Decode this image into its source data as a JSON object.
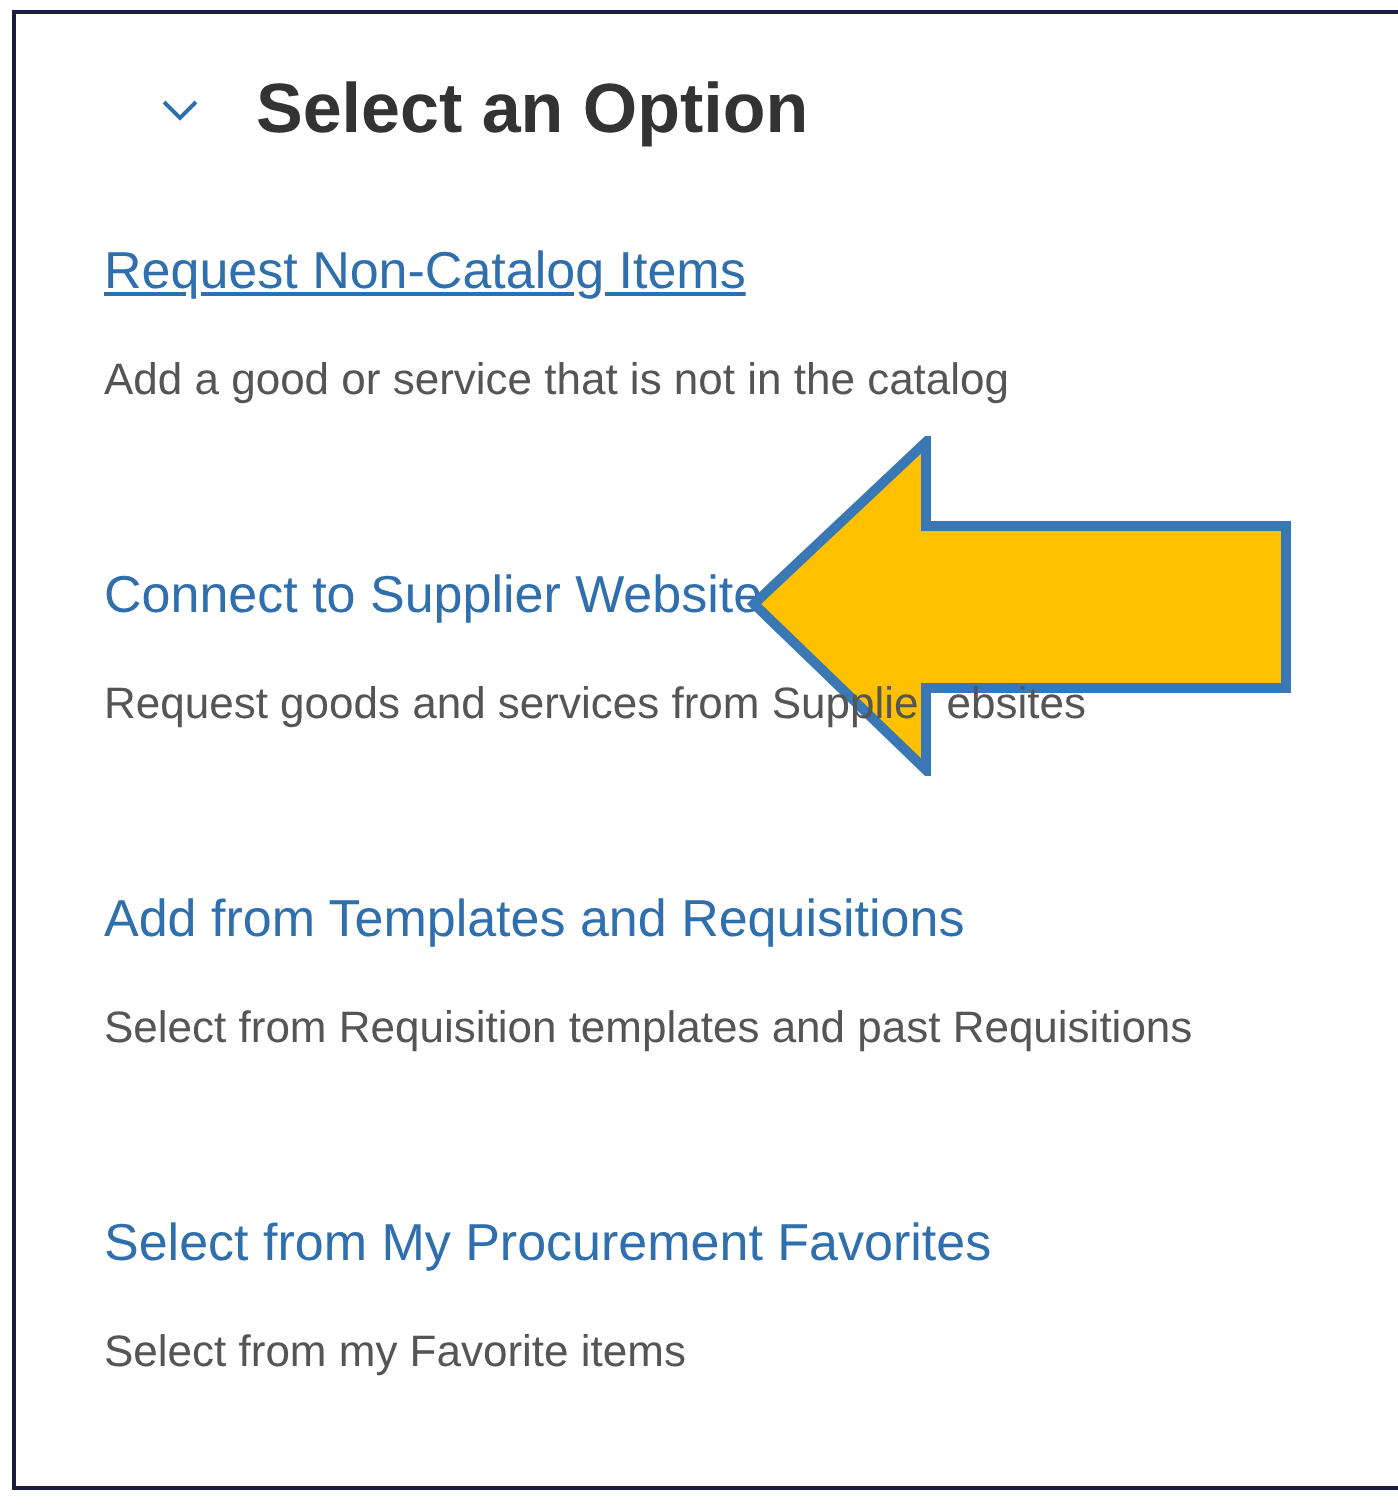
{
  "header": {
    "title": "Select an Option",
    "expanded": true
  },
  "options": [
    {
      "link": "Request Non-Catalog Items",
      "hovered": true,
      "description": [
        "Add a good or service that is not in the catalog"
      ]
    },
    {
      "link": "Connect to Supplier Website",
      "hovered": false,
      "description": [
        "Request goods and services from Supplie",
        "ebsites"
      ]
    },
    {
      "link": "Add from Templates and Requisitions",
      "hovered": false,
      "description": [
        "Select from Requisition templates and past Requisitions"
      ]
    },
    {
      "link": "Select from My Procurement Favorites",
      "hovered": false,
      "description": [
        "Select from my Favorite items"
      ]
    }
  ]
}
